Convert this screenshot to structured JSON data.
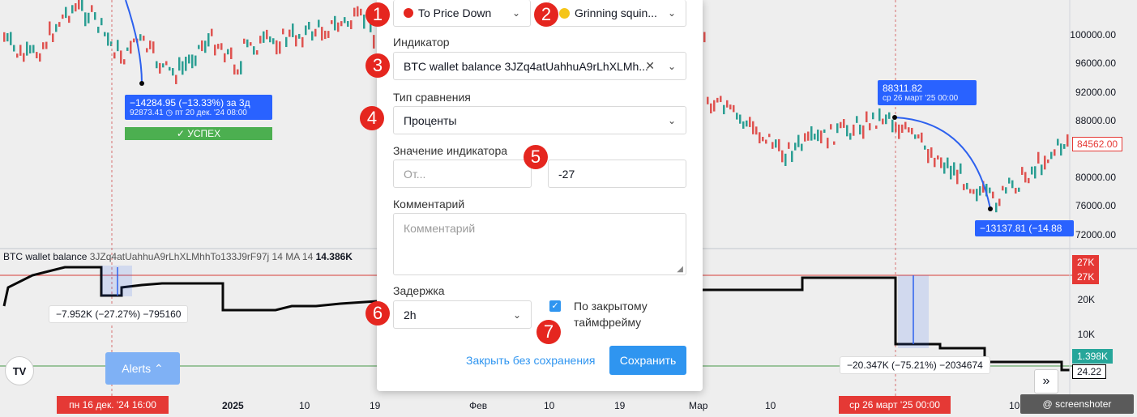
{
  "chart": {
    "y_labels": [
      "100000.00",
      "96000.00",
      "92000.00",
      "88000.00",
      "80000.00",
      "76000.00",
      "72000.00"
    ],
    "price_tag_red": "84562.00",
    "indicator_labels": [
      "20K",
      "10K"
    ],
    "tag_27k_a": "27K",
    "tag_27k_b": "27K",
    "tag_1398": "1.398K",
    "tag_2422": "24.22",
    "x_labels": [
      "2025",
      "10",
      "19",
      "Фев",
      "10",
      "19",
      "Мар",
      "10",
      "10"
    ],
    "x_cursor_left": "пн 16 дек. '24   16:00",
    "x_cursor_right": "ср 26 март '25   00:00",
    "indicator_title_prefix": "BTC wallet balance",
    "indicator_title_id": "3JZq4atUahhuA9rLhXLMhhTo133J9rF97j 14 MA 14",
    "indicator_title_value": "14.386K",
    "callout_left_main": "−14284.95 (−13.33%) за 3д",
    "callout_left_sub": "92873.41 ◷ пт 20 дек. '24   08:00",
    "success_label": "✓ УСПЕХ",
    "callout_right_main": "88311.82",
    "callout_right_sub": "ср 26 март '25 00:00",
    "callout_right_bottom": "−13137.81 (−14.88",
    "pill_left": "−7.952K (−27.27%) −795160",
    "pill_right": "−20.347K (−75.21%) −2034674",
    "alerts_button": "Alerts ⌃",
    "watermark": "@ screenshoter",
    "tv_logo": "TV",
    "scroll_right": "»"
  },
  "dialog": {
    "badges": [
      "1",
      "2",
      "3",
      "4",
      "5",
      "6",
      "7"
    ],
    "condition_select": "To Price Down",
    "emoji_select": "Grinning squin...",
    "indicator_label": "Индикатор",
    "indicator_value": "BTC wallet balance 3JZq4atUahhuA9rLhXLMh...",
    "compare_label": "Тип сравнения",
    "compare_value": "Проценты",
    "value_label": "Значение индикатора",
    "value_from_placeholder": "От...",
    "value_to": "-27",
    "comment_label": "Комментарий",
    "comment_placeholder": "Комментарий",
    "delay_label": "Задержка",
    "delay_value": "2h",
    "closed_tf_label": "По закрытому таймфрейму",
    "close_without_save": "Закрыть без сохранения",
    "save": "Сохранить"
  },
  "colors": {
    "accent": "#2f95f0",
    "badge_red": "#e5261f",
    "callout_blue": "#2962ff",
    "success_green": "#4caf50"
  }
}
